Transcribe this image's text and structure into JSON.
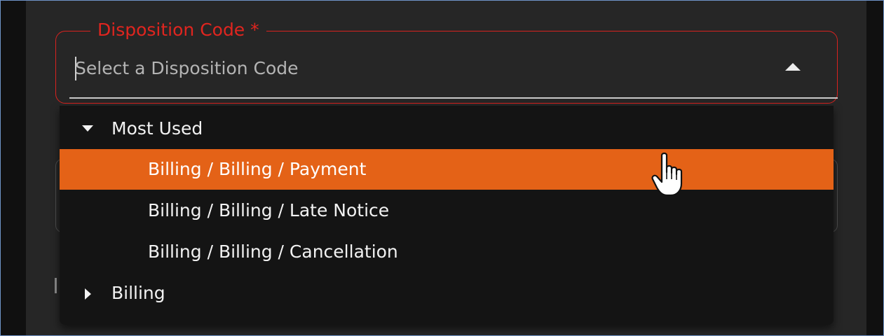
{
  "select_field": {
    "label": "Disposition Code *",
    "placeholder": "Select a Disposition Code",
    "state": "open",
    "accent_color": "#d9221f"
  },
  "dropdown": {
    "groups": [
      {
        "label": "Most Used",
        "expanded": true,
        "icon": "triangle-down-icon",
        "options": [
          {
            "label": "Billing / Billing / Payment",
            "highlighted": true
          },
          {
            "label": "Billing / Billing / Late Notice",
            "highlighted": false
          },
          {
            "label": "Billing / Billing / Cancellation",
            "highlighted": false
          }
        ]
      },
      {
        "label": "Billing",
        "expanded": false,
        "icon": "triangle-right-icon"
      }
    ],
    "highlight_color": "#e46217"
  },
  "cursor": {
    "icon": "hand-pointer-icon"
  }
}
